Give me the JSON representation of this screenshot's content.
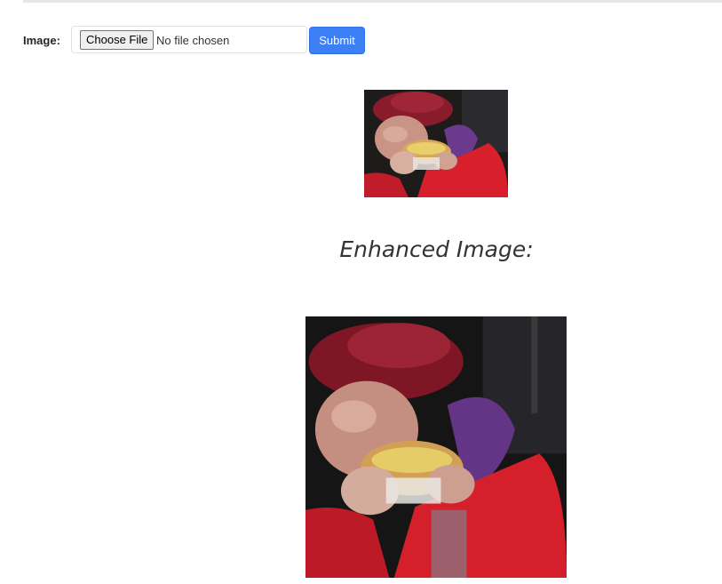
{
  "form": {
    "image_label": "Image:",
    "choose_file_label": "Choose File",
    "file_status": "No file chosen",
    "submit_label": "Submit"
  },
  "result": {
    "enhanced_heading": "Enhanced Image:"
  },
  "colors": {
    "submit_button": "#3d7ff5",
    "hat": "#8a1b2a",
    "jacket": "#d8202c",
    "scarf": "#6b3a8f",
    "background_dark": "#1a1a1a",
    "bread": "#d7a85a"
  },
  "icons": {
    "original_photo": "photo-person-eating-hotdog",
    "enhanced_photo": "photo-person-eating-hotdog-enhanced"
  }
}
